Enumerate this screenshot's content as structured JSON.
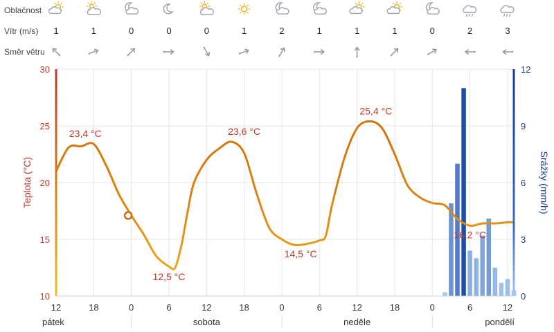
{
  "header": {
    "row_labels": {
      "clouds": "Oblačnost",
      "wind": "Vítr (m/s)",
      "dir": "Směr větru"
    },
    "columns": [
      {
        "x": 12,
        "sky": "partly-sunny-icon",
        "wind": "1",
        "dir": 225
      },
      {
        "x": 18,
        "sky": "cloudy-sun-icon",
        "wind": "1",
        "dir": 340
      },
      {
        "x": 24,
        "sky": "moon-cloud-icon",
        "wind": "0",
        "dir": 315
      },
      {
        "x": 30,
        "sky": "moon-icon",
        "wind": "0",
        "dir": 0
      },
      {
        "x": 36,
        "sky": "cloudy-sun-icon",
        "wind": "0",
        "dir": 60
      },
      {
        "x": 42,
        "sky": "sun-icon",
        "wind": "1",
        "dir": 340
      },
      {
        "x": 48,
        "sky": "moon-cloud-icon",
        "wind": "2",
        "dir": 300
      },
      {
        "x": 54,
        "sky": "moon-cloud-icon",
        "wind": "1",
        "dir": 0
      },
      {
        "x": 60,
        "sky": "partly-sunny-icon",
        "wind": "1",
        "dir": 270
      },
      {
        "x": 66,
        "sky": "partly-sunny-icon",
        "wind": "1",
        "dir": 315
      },
      {
        "x": 72,
        "sky": "moon-cloud-icon",
        "wind": "0",
        "dir": 330
      },
      {
        "x": 78,
        "sky": "rain-cloud-icon",
        "wind": "2",
        "dir": 180
      },
      {
        "x": 84,
        "sky": "rain-cloud-icon",
        "wind": "3",
        "dir": 180
      }
    ]
  },
  "chart_data": {
    "type": "line",
    "xlabel": "",
    "x_axis": {
      "tick_labels": [
        "12",
        "18",
        "0",
        "6",
        "12",
        "18",
        "0",
        "6",
        "12",
        "18",
        "0",
        "6",
        "12"
      ],
      "tick_hours": [
        12,
        18,
        24,
        30,
        36,
        42,
        48,
        54,
        60,
        66,
        72,
        78,
        84
      ],
      "days": [
        {
          "label": "pátek",
          "hour": 12,
          "align": "start"
        },
        {
          "label": "sobota",
          "hour": 36,
          "align": "middle"
        },
        {
          "label": "neděle",
          "hour": 60,
          "align": "middle"
        },
        {
          "label": "pondělí",
          "hour": 84,
          "align": "end"
        }
      ],
      "day_boundaries": [
        24,
        48,
        72
      ],
      "range": [
        12,
        85
      ]
    },
    "y_left": {
      "label": "Teplota (°C)",
      "range": [
        10,
        30
      ],
      "ticks": [
        10,
        15,
        20,
        25,
        30
      ]
    },
    "y_right": {
      "label": "Srážky (mm/h)",
      "range": [
        0,
        12
      ],
      "ticks": [
        0,
        3,
        6,
        9,
        12
      ]
    },
    "series": [
      {
        "name": "Teplota",
        "kind": "line",
        "axis": "left",
        "x": [
          12,
          14,
          16,
          18,
          20,
          22,
          24,
          26,
          28,
          30,
          31,
          32,
          33,
          34,
          36,
          38,
          40,
          42,
          44,
          46,
          48,
          50,
          52,
          54,
          55,
          56,
          58,
          60,
          62,
          64,
          66,
          68,
          70,
          72,
          74,
          76,
          78,
          80,
          82,
          84,
          85
        ],
        "y": [
          21.0,
          23.1,
          23.2,
          23.4,
          21.5,
          19.0,
          17.1,
          15.4,
          13.5,
          12.6,
          12.5,
          14.5,
          17.5,
          20.0,
          22.0,
          23.0,
          23.6,
          22.6,
          19.0,
          16.0,
          15.0,
          14.5,
          14.6,
          14.9,
          15.3,
          18.0,
          22.2,
          24.8,
          25.4,
          24.8,
          22.5,
          19.8,
          18.7,
          18.2,
          18.0,
          16.8,
          16.2,
          16.4,
          16.4,
          16.5,
          16.5
        ]
      },
      {
        "name": "Srážky",
        "kind": "bar",
        "axis": "right",
        "x": [
          74,
          75,
          76,
          77,
          78,
          79,
          80,
          81,
          82,
          83,
          84,
          85
        ],
        "y": [
          0.2,
          4.9,
          7.0,
          11.0,
          2.4,
          2.0,
          3.2,
          4.1,
          1.5,
          0.7,
          0.9,
          0.3
        ]
      }
    ],
    "annotations": [
      {
        "x": 18,
        "y": 23.4,
        "label": "23,4 °C"
      },
      {
        "x": 30,
        "y": 12.5,
        "label": "12,5 °C"
      },
      {
        "x": 42,
        "y": 23.6,
        "label": "23,6 °C"
      },
      {
        "x": 51,
        "y": 14.5,
        "label": "14,5 °C"
      },
      {
        "x": 63,
        "y": 25.4,
        "label": "25,4 °C"
      },
      {
        "x": 78,
        "y": 16.2,
        "label": "16,2 °C"
      }
    ],
    "marker": {
      "x": 23.5,
      "y": 17.1
    },
    "grid": true,
    "colors": {
      "temp_warm": "#c9690e",
      "temp_cool": "#f0b21a",
      "left_axis": "#c0392b",
      "right_axis": "#1a3d8f",
      "rain_dark": "#1f4fa8",
      "rain_light": "#a9c9f2",
      "annotation": "#c0392b",
      "grid": "#e6e6e6"
    }
  }
}
